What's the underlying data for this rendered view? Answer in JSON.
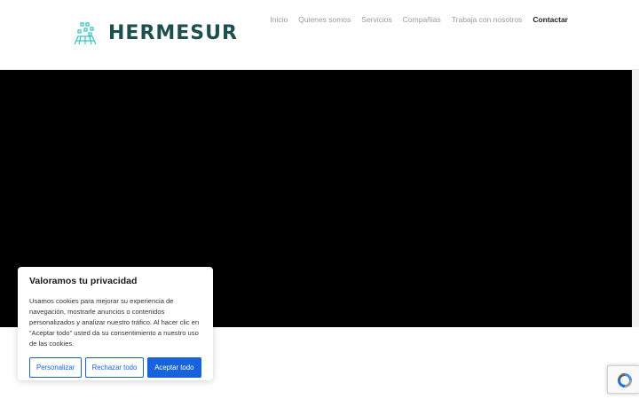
{
  "brand": {
    "name": "HERMESUR",
    "color": "#1c4f4d",
    "accent": "#3ec6c0"
  },
  "nav": {
    "items": [
      {
        "label": "Inicio"
      },
      {
        "label": "Quienes somos"
      },
      {
        "label": "Servicios"
      },
      {
        "label": "Compañias"
      },
      {
        "label": "Trabaja con nosotros"
      },
      {
        "label": "Contactar"
      }
    ],
    "active": "Contactar"
  },
  "hero": {
    "background": "#000000"
  },
  "cookie_banner": {
    "title": "Valoramos tu privacidad",
    "body": "Usamos cookies para mejorar su experiencia de navegación, mostrarle anuncios o contenidos personalizados y analizar nuestro tráfico. Al hacer clic en “Aceptar todo” usted da su consentimiento a nuestro uso de las cookies.",
    "buttons": {
      "customize": "Personalizar",
      "reject": "Rechazar todo",
      "accept": "Aceptar todo"
    },
    "accent": "#1863dc"
  },
  "recaptcha": {
    "icon": "recaptcha-icon"
  }
}
